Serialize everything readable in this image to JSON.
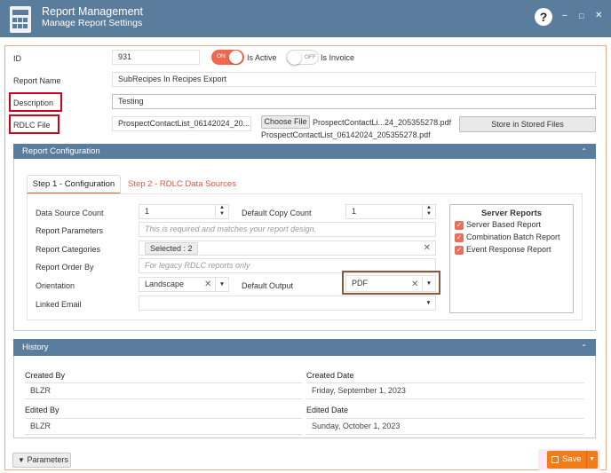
{
  "titlebar": {
    "title": "Report Management",
    "subtitle": "Manage Report Settings",
    "help_glyph": "?",
    "minimize_glyph": "–",
    "maximize_glyph": "□",
    "close_glyph": "✕"
  },
  "form": {
    "id_label": "ID",
    "id_value": "931",
    "is_active": {
      "state_text": "ON",
      "label": "Is Active",
      "on": true
    },
    "is_invoice": {
      "state_text": "OFF",
      "label": "Is Invoice",
      "on": false
    },
    "report_name_label": "Report Name",
    "report_name_value": "SubRecipes In Recipes Export",
    "description_label": "Description",
    "description_value": "Testing",
    "rdlc_label": "RDLC File",
    "rdlc_value": "ProspectContactList_06142024_20...",
    "choose_file_label": "Choose File",
    "chosen_file_name": "ProspectContactLi...24_205355278.pdf",
    "file_full_name": "ProspectContactList_06142024_205355278.pdf",
    "store_button_label": "Store in Stored Files"
  },
  "report_config": {
    "header": "Report Configuration",
    "collapse_glyph": "⌃",
    "tabs": [
      "Step 1 - Configuration",
      "Step 2 - RDLC Data Sources"
    ],
    "data_source_count_label": "Data Source Count",
    "data_source_count_value": "1",
    "default_copy_count_label": "Default Copy Count",
    "default_copy_count_value": "1",
    "report_parameters_label": "Report Parameters",
    "report_parameters_placeholder": "This is required and matches your report design.",
    "report_categories_label": "Report Categories",
    "report_categories_value": "Selected : 2",
    "report_order_by_label": "Report Order By",
    "report_order_by_placeholder": "For legacy RDLC reports only",
    "orientation_label": "Orientation",
    "orientation_value": "Landscape",
    "default_output_label": "Default Output",
    "default_output_value": "PDF",
    "linked_email_label": "Linked Email",
    "linked_email_value": "",
    "server_reports": {
      "title": "Server Reports",
      "items": [
        {
          "label": "Server Based Report",
          "checked": true
        },
        {
          "label": "Combination Batch Report",
          "checked": true
        },
        {
          "label": "Event Response Report",
          "checked": true
        }
      ]
    }
  },
  "history": {
    "header": "History",
    "created_by_label": "Created By",
    "created_by_value": "BLZR",
    "created_date_label": "Created Date",
    "created_date_value": "Friday, September 1, 2023",
    "edited_by_label": "Edited By",
    "edited_by_value": "BLZR",
    "edited_date_label": "Edited Date",
    "edited_date_value": "Sunday, October 1, 2023"
  },
  "footer": {
    "parameters_label": "Parameters",
    "save_label": "Save"
  },
  "colors": {
    "titlebar": "#5b7d9d",
    "accent": "#f05a28",
    "save": "#f07c1a",
    "highlight_red": "#d0021b",
    "highlight_brown": "#8b5a3c"
  },
  "icons": [
    "app-calendar-icon",
    "help-icon",
    "minimize-icon",
    "maximize-icon",
    "close-icon",
    "filter-icon",
    "save-icon"
  ]
}
